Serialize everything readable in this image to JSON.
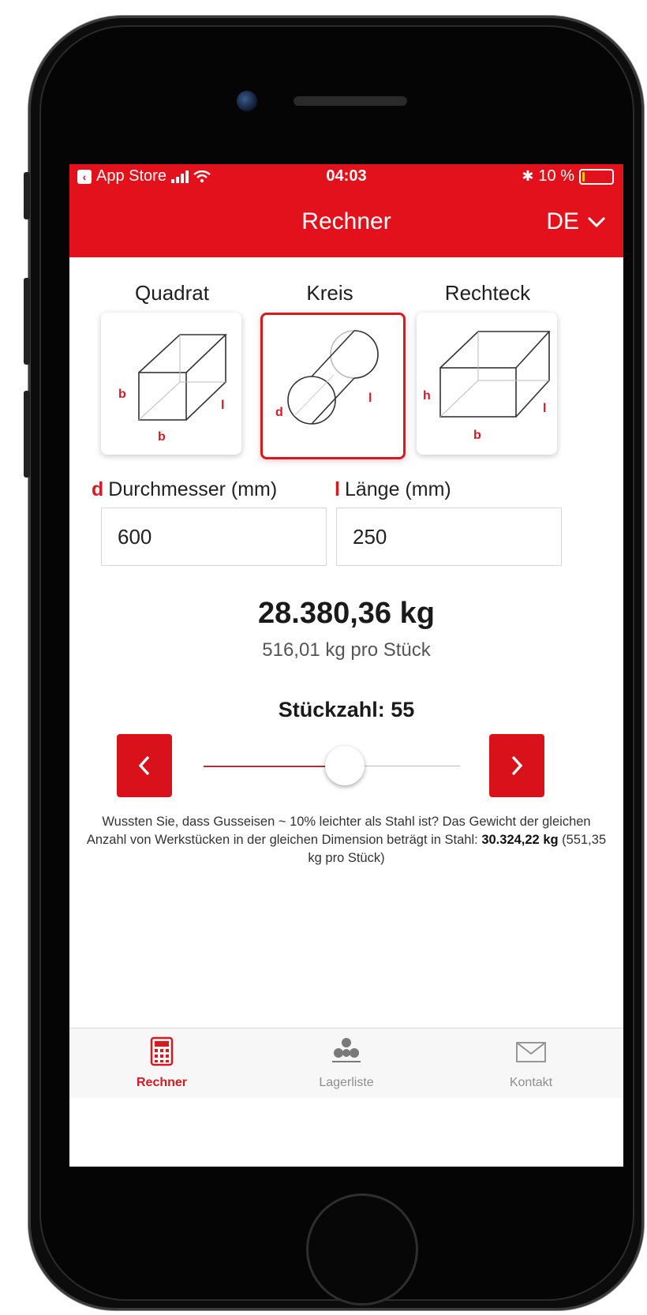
{
  "status_bar": {
    "back_app": "App Store",
    "time": "04:03",
    "battery": "10 %",
    "battery_level": 0.1
  },
  "nav": {
    "title": "Rechner",
    "language": "DE"
  },
  "shapes": [
    {
      "label": "Quadrat",
      "dim_left": "b",
      "dim_bottom": "b",
      "dim_right": "l",
      "selected": false
    },
    {
      "label": "Kreis",
      "dim_left": "d",
      "dim_right": "l",
      "selected": true
    },
    {
      "label": "Rechteck",
      "dim_left": "h",
      "dim_bottom": "b",
      "dim_right": "l",
      "selected": false
    }
  ],
  "fields": {
    "diameter": {
      "mark": "d",
      "label": "Durchmesser (mm)",
      "value": "600"
    },
    "length": {
      "mark": "l",
      "label": "Länge (mm)",
      "value": "250"
    }
  },
  "result": {
    "total": "28.380,36 kg",
    "per_piece": "516,01 kg pro Stück"
  },
  "quantity": {
    "label": "Stückzahl: 55",
    "slider_fraction": 0.55
  },
  "info": {
    "text_1": "Wussten Sie, dass Gusseisen ~ 10% leichter als Stahl ist? Das Gewicht der gleichen Anzahl von Werkstücken in der gleichen Dimension beträgt in Stahl: ",
    "steel_total": "30.324,22 kg",
    "text_2": " (551,35 kg pro Stück)"
  },
  "tabs": [
    {
      "label": "Rechner",
      "icon": "calculator-icon",
      "active": true
    },
    {
      "label": "Lagerliste",
      "icon": "stock-list-icon",
      "active": false
    },
    {
      "label": "Kontakt",
      "icon": "envelope-icon",
      "active": false
    }
  ],
  "colors": {
    "accent": "#e3111b",
    "tab_inactive": "#8e8e8e"
  }
}
